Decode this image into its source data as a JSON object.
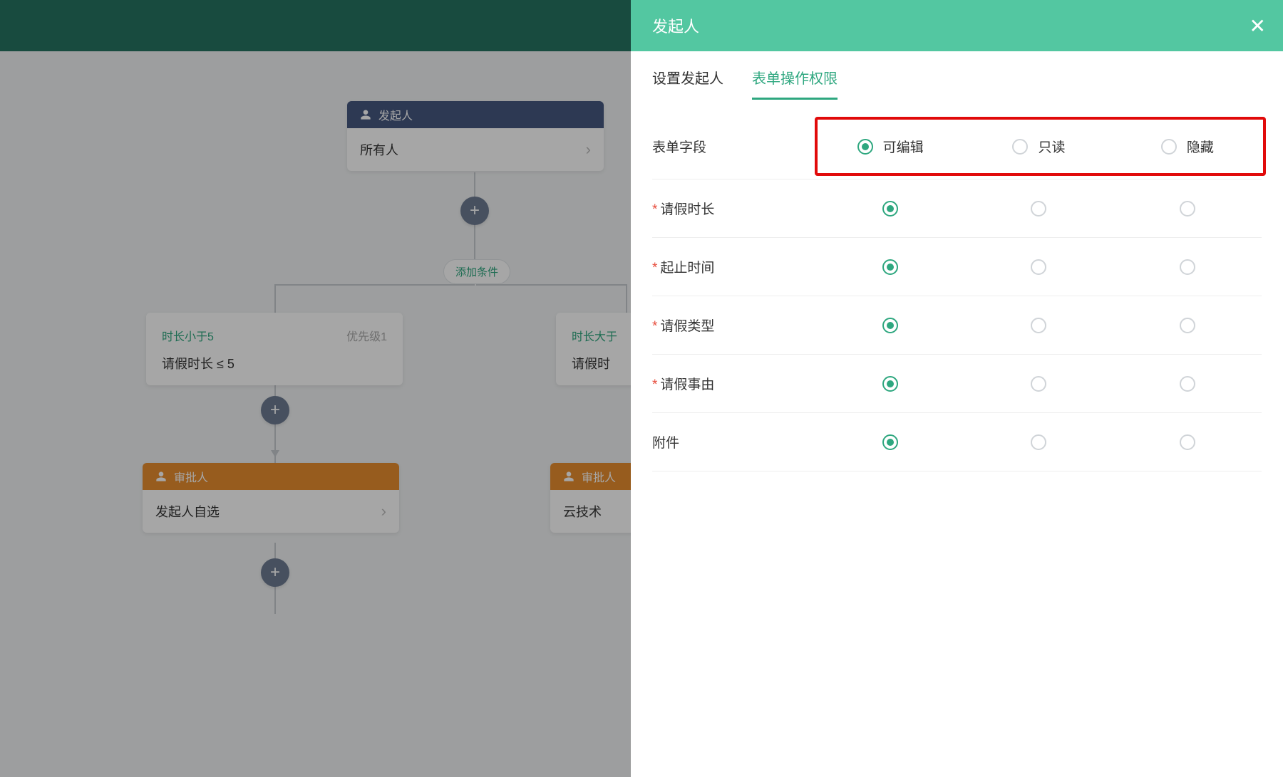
{
  "topbar": {},
  "flow": {
    "initiator": {
      "header": "发起人",
      "body": "所有人"
    },
    "addCondition": "添加条件",
    "branches": [
      {
        "title": "时长小于5",
        "priority": "优先级1",
        "expr": "请假时长 ≤ 5"
      },
      {
        "title": "时长大于",
        "priority": "",
        "expr": "请假时"
      }
    ],
    "approvers": [
      {
        "header": "审批人",
        "body": "发起人自选"
      },
      {
        "header": "审批人",
        "body": "云技术"
      }
    ],
    "plus": "+"
  },
  "panel": {
    "title": "发起人",
    "tabs": {
      "settings": "设置发起人",
      "permissions": "表单操作权限"
    },
    "columns": {
      "field": "表单字段",
      "editable": "可编辑",
      "readonly": "只读",
      "hidden": "隐藏"
    },
    "fields": [
      {
        "required": true,
        "label": "请假时长",
        "value": "editable"
      },
      {
        "required": true,
        "label": "起止时间",
        "value": "editable"
      },
      {
        "required": true,
        "label": "请假类型",
        "value": "editable"
      },
      {
        "required": true,
        "label": "请假事由",
        "value": "editable"
      },
      {
        "required": false,
        "label": "附件",
        "value": "editable"
      }
    ]
  }
}
